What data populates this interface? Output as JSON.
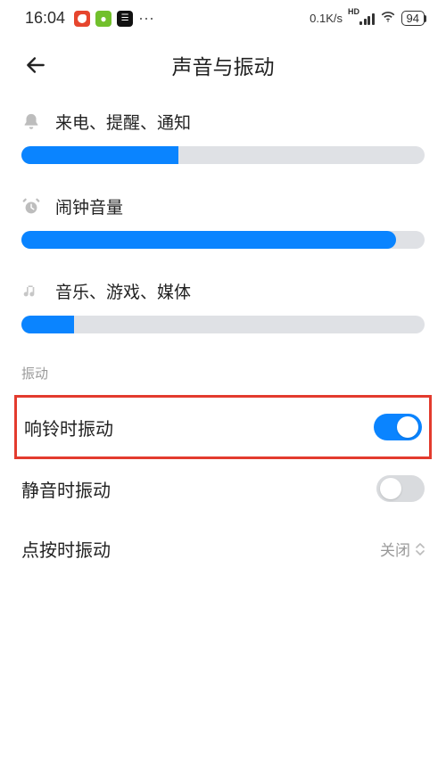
{
  "status_bar": {
    "time": "16:04",
    "net_speed": "0.1K/s",
    "net_type": "HD",
    "battery": "94"
  },
  "header": {
    "title": "声音与振动"
  },
  "sliders": [
    {
      "label": "来电、提醒、通知",
      "icon": "bell",
      "percent": 39
    },
    {
      "label": "闹钟音量",
      "icon": "alarm",
      "percent": 93
    },
    {
      "label": "音乐、游戏、媒体",
      "icon": "music",
      "percent": 13
    }
  ],
  "section_vibration_label": "振动",
  "toggles": {
    "ring_vibrate": {
      "label": "响铃时振动",
      "on": true,
      "highlighted": true
    },
    "silent_vibrate": {
      "label": "静音时振动",
      "on": false
    }
  },
  "tap_vibrate": {
    "label": "点按时振动",
    "value": "关闭"
  }
}
